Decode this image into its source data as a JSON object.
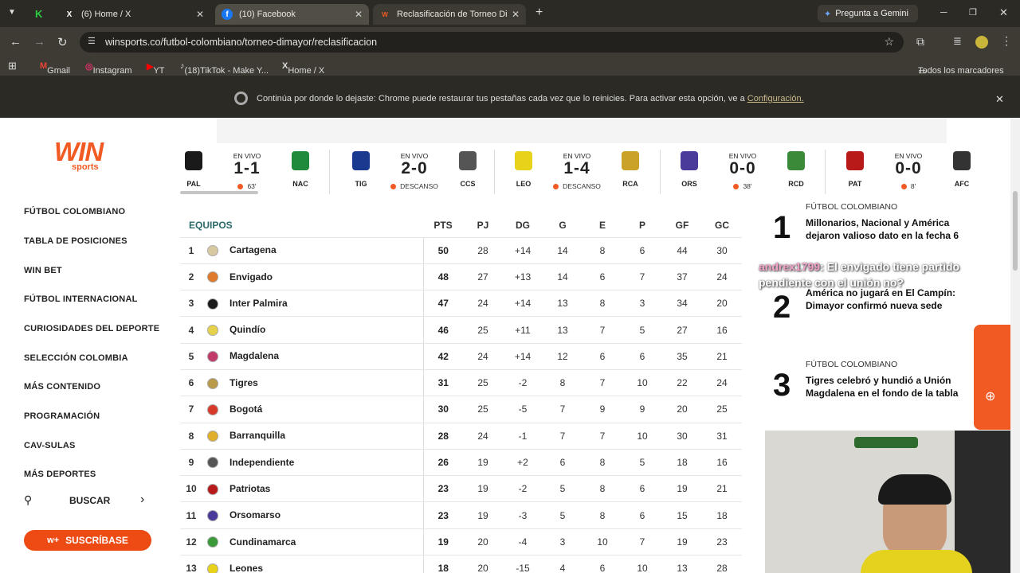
{
  "browser": {
    "tabs": [
      {
        "title": "(6) Home / X"
      },
      {
        "title": "(10) Facebook"
      },
      {
        "title": "Reclasificación de Torneo Dima..."
      }
    ],
    "gemini": "Pregunta a Gemini",
    "url": "winsports.co/futbol-colombiano/torneo-dimayor/reclasificacion",
    "bookmarks": [
      "Gmail",
      "Instagram",
      "YT",
      "(18)TikTok - Make Y...",
      "Home / X"
    ],
    "all_bookmarks": "Todos los marcadores",
    "infobar": {
      "message": "Continúa por donde lo dejaste: Chrome puede restaurar tus pestañas cada vez que lo reinicies. Para activar esta opción, ve a",
      "link": "Configuración."
    }
  },
  "site": {
    "logo_main": "WIN",
    "logo_sub": "sports",
    "menu": [
      "FÚTBOL COLOMBIANO",
      "TABLA DE POSICIONES",
      "WIN BET",
      "FÚTBOL INTERNACIONAL",
      "CURIOSIDADES DEL DEPORTE",
      "SELECCIÓN COLOMBIA",
      "MÁS CONTENIDO",
      "PROGRAMACIÓN",
      "CAV-SULAS",
      "MÁS DEPORTES"
    ],
    "search": "BUSCAR",
    "subscribe": "SUSCRÍBASE"
  },
  "matches": [
    {
      "home": "PAL",
      "away": "NAC",
      "status": "EN VIVO",
      "score": "1-1",
      "time": "63'",
      "home_color": "#1a1a1a",
      "away_color": "#1f8a3b"
    },
    {
      "home": "TIG",
      "away": "CCS",
      "status": "EN VIVO",
      "score": "2-0",
      "time": "DESCANSO",
      "home_color": "#1a3a8f",
      "away_color": "#555555"
    },
    {
      "home": "LEO",
      "away": "RCA",
      "status": "EN VIVO",
      "score": "1-4",
      "time": "DESCANSO",
      "home_color": "#e8d21a",
      "away_color": "#c9a227"
    },
    {
      "home": "ORS",
      "away": "RCD",
      "status": "EN VIVO",
      "score": "0-0",
      "time": "38'",
      "home_color": "#4a3a9a",
      "away_color": "#3a8a3a"
    },
    {
      "home": "PAT",
      "away": "AFC",
      "status": "EN VIVO",
      "score": "0-0",
      "time": "8'",
      "home_color": "#b81a1a",
      "away_color": "#333333"
    }
  ],
  "table": {
    "headers": [
      "EQUIPOS",
      "PTS",
      "PJ",
      "DG",
      "G",
      "E",
      "P",
      "GF",
      "GC"
    ],
    "rows": [
      {
        "pos": "1",
        "team": "Cartagena",
        "pts": "50",
        "pj": "28",
        "dg": "+14",
        "g": "14",
        "e": "8",
        "p": "6",
        "gf": "44",
        "gc": "30",
        "color": "#d8c9a0"
      },
      {
        "pos": "2",
        "team": "Envigado",
        "pts": "48",
        "pj": "27",
        "dg": "+13",
        "g": "14",
        "e": "6",
        "p": "7",
        "gf": "37",
        "gc": "24",
        "color": "#e07a2a"
      },
      {
        "pos": "3",
        "team": "Inter Palmira",
        "pts": "47",
        "pj": "24",
        "dg": "+14",
        "g": "13",
        "e": "8",
        "p": "3",
        "gf": "34",
        "gc": "20",
        "color": "#1a1a1a"
      },
      {
        "pos": "4",
        "team": "Quindío",
        "pts": "46",
        "pj": "25",
        "dg": "+11",
        "g": "13",
        "e": "7",
        "p": "5",
        "gf": "27",
        "gc": "16",
        "color": "#e5d24a"
      },
      {
        "pos": "5",
        "team": "Magdalena",
        "pts": "42",
        "pj": "24",
        "dg": "+14",
        "g": "12",
        "e": "6",
        "p": "6",
        "gf": "35",
        "gc": "21",
        "color": "#c03a6a"
      },
      {
        "pos": "6",
        "team": "Tigres",
        "pts": "31",
        "pj": "25",
        "dg": "-2",
        "g": "8",
        "e": "7",
        "p": "10",
        "gf": "22",
        "gc": "24",
        "color": "#b89a4a"
      },
      {
        "pos": "7",
        "team": "Bogotá",
        "pts": "30",
        "pj": "25",
        "dg": "-5",
        "g": "7",
        "e": "9",
        "p": "9",
        "gf": "20",
        "gc": "25",
        "color": "#d83a2a"
      },
      {
        "pos": "8",
        "team": "Barranquilla",
        "pts": "28",
        "pj": "24",
        "dg": "-1",
        "g": "7",
        "e": "7",
        "p": "10",
        "gf": "30",
        "gc": "31",
        "color": "#e0b02a"
      },
      {
        "pos": "9",
        "team": "Independiente",
        "pts": "26",
        "pj": "19",
        "dg": "+2",
        "g": "6",
        "e": "8",
        "p": "5",
        "gf": "18",
        "gc": "16",
        "color": "#555555"
      },
      {
        "pos": "10",
        "team": "Patriotas",
        "pts": "23",
        "pj": "19",
        "dg": "-2",
        "g": "5",
        "e": "8",
        "p": "6",
        "gf": "19",
        "gc": "21",
        "color": "#b81a1a"
      },
      {
        "pos": "11",
        "team": "Orsomarso",
        "pts": "23",
        "pj": "19",
        "dg": "-3",
        "g": "5",
        "e": "8",
        "p": "6",
        "gf": "15",
        "gc": "18",
        "color": "#4a3a9a"
      },
      {
        "pos": "12",
        "team": "Cundinamarca",
        "pts": "19",
        "pj": "20",
        "dg": "-4",
        "g": "3",
        "e": "10",
        "p": "7",
        "gf": "19",
        "gc": "23",
        "color": "#3a9a3a"
      },
      {
        "pos": "13",
        "team": "Leones",
        "pts": "18",
        "pj": "20",
        "dg": "-15",
        "g": "4",
        "e": "6",
        "p": "10",
        "gf": "13",
        "gc": "28",
        "color": "#e8d21a"
      }
    ]
  },
  "news": [
    {
      "num": "1",
      "category": "FÚTBOL COLOMBIANO",
      "headline": "Millonarios, Nacional y América dejaron valioso dato en la fecha 6"
    },
    {
      "num": "2",
      "category": "",
      "headline": "América no jugará en El Campín: Dimayor confirmó nueva sede"
    },
    {
      "num": "3",
      "category": "FÚTBOL COLOMBIANO",
      "headline": "Tigres celebró y hundió a Unión Magdalena en el fondo de la tabla"
    }
  ],
  "chat": {
    "user": "andrex1799",
    "message": ": El envigado tiene partido pendiente con el unión no?"
  },
  "colors": {
    "brand": "#f15a22",
    "chrome_dark": "#2b2a25"
  }
}
